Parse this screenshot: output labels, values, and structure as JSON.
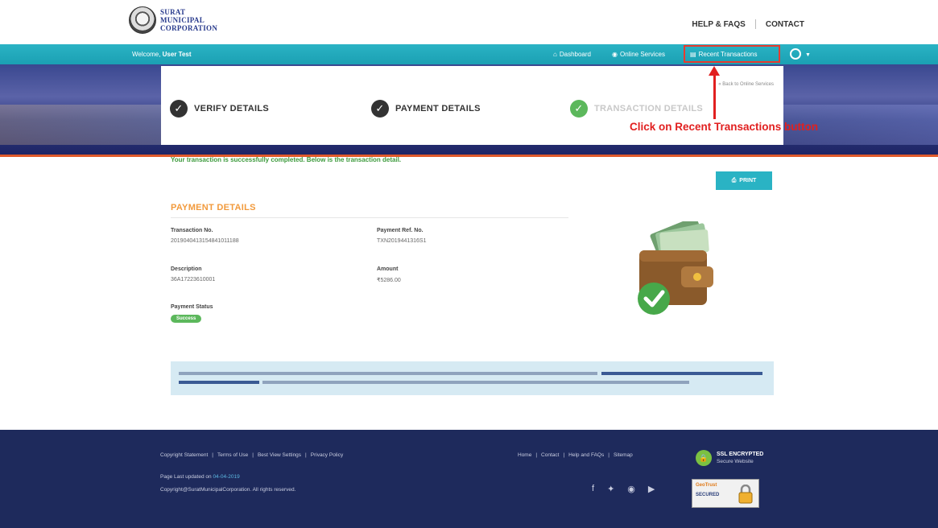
{
  "header": {
    "logo_lines": [
      "SURAT",
      "MUNICIPAL",
      "CORPORATION"
    ],
    "links": [
      "HELP & FAQS",
      "CONTACT"
    ]
  },
  "navbar": {
    "welcome_prefix": "Welcome,",
    "welcome_user": "User Test",
    "items": [
      "Dashboard",
      "Online Services",
      "Recent Transactions"
    ]
  },
  "steps": {
    "back_link": "« Back to Online Services",
    "items": [
      "VERIFY DETAILS",
      "PAYMENT DETAILS",
      "TRANSACTION DETAILS"
    ]
  },
  "annotation": "Click on Recent Transactions button",
  "content": {
    "success_message": "Your transaction is successfully completed. Below is the transaction detail.",
    "print_label": "PRINT",
    "section_title": "PAYMENT DETAILS",
    "fields": {
      "transaction_no_label": "Transaction No.",
      "transaction_no": "2019040413154841011188",
      "payment_ref_label": "Payment Ref. No.",
      "payment_ref": "TXN2019441316S1",
      "description_label": "Description",
      "description": "36A17223610001",
      "amount_label": "Amount",
      "amount": "₹5286.00",
      "status_label": "Payment Status",
      "status": "Success"
    }
  },
  "footer": {
    "links_left": [
      "Copyright Statement",
      "Terms of Use",
      "Best View Settings",
      "Privacy Policy"
    ],
    "links_right": [
      "Home",
      "Contact",
      "Help and FAQs",
      "Sitemap"
    ],
    "updated_prefix": "Page Last updated on",
    "updated_date": "04-04-2019",
    "copyright": "Copyright@SuratMunicipalCorporation. All rights reserved.",
    "ssl_title": "SSL ENCRYPTED",
    "ssl_sub": "Secure Website",
    "badge_name": "GeoTrust",
    "badge_secured": "SECURED"
  },
  "colors": {
    "teal": "#2ab3c4",
    "annotation_red": "#e12020",
    "success_green": "#5cb85c",
    "section_orange": "#f29a3c",
    "footer_navy": "#1e2a5c"
  }
}
